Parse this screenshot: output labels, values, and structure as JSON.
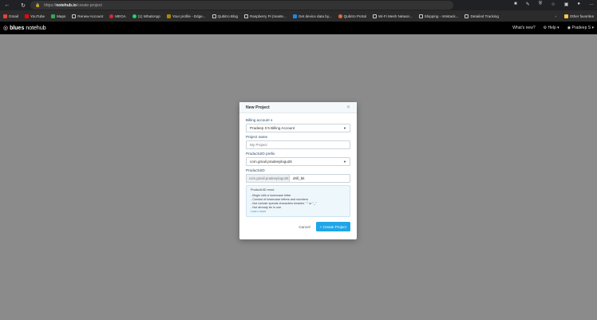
{
  "browser": {
    "url_prefix": "https://",
    "url_domain": "notehub.io",
    "url_path": "/create-project",
    "bookmarks": [
      "Gmail",
      "YouTube",
      "Maps",
      "Renew Account",
      "MEGA",
      "(1) WhatsApp",
      "Your profile - Edge...",
      "Qubitro Blog",
      "Raspberry Pi (maste...",
      "Get device data by...",
      "Qubitro Portal",
      "Wi-Fi Mesh Networ...",
      "Shipping - m5stack...",
      "Detailed Tracking"
    ],
    "other_favorites": "Other favorites"
  },
  "header": {
    "logo_bold": "blues",
    "logo_light": "notehub",
    "whats_new": "What's new?",
    "help": "Help",
    "user": "Pradeep S"
  },
  "modal": {
    "title": "New Project",
    "billing_label": "Billing account",
    "billing_value": "Pradeep S's Billing Account",
    "name_label": "Project name",
    "name_placeholder": "My Project",
    "prefix_label": "ProductUID prefix",
    "prefix_value": "com.gmail.pradeeplogu26",
    "uid_label": "ProductUID",
    "uid_prefix": "com.gmail.pradeeplogu26:",
    "uid_value": "drill_bit",
    "rules_title": "ProductUID must:",
    "rules": [
      "- Begin with a lowercase letter",
      "- Consist of lowercase letters and numbers",
      "- Not contain special characters besides \".\" or \"_\"",
      "- Not already be in use"
    ],
    "learn_more": "Learn more",
    "cancel": "Cancel",
    "create": "Create Project"
  }
}
